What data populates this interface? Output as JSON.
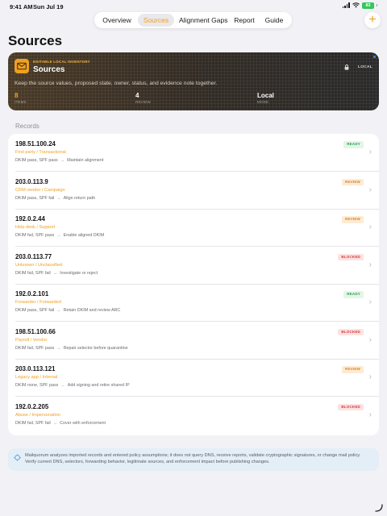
{
  "status_bar": {
    "time": "9:41 AM",
    "date": "Sun Jul 19",
    "battery": "83"
  },
  "nav": {
    "tabs": [
      {
        "label": "Overview",
        "active": false
      },
      {
        "label": "Sources",
        "active": true
      },
      {
        "label": "Alignment Gaps",
        "active": false
      },
      {
        "label": "Report",
        "active": false
      },
      {
        "label": "Guide",
        "active": false
      }
    ],
    "add_icon": "plus-icon"
  },
  "page": {
    "title": "Sources"
  },
  "hero": {
    "eyebrow": "EDITABLE LOCAL INVENTORY",
    "title": "Sources",
    "badge": "LOCAL",
    "description": "Keep the source values, proposed state, owner, status, and evidence note together.",
    "stats": [
      {
        "value": "8",
        "label": "ITEMS",
        "accent": true
      },
      {
        "value": "4",
        "label": "REVIEW",
        "accent": false
      },
      {
        "value": "Local",
        "label": "MODE",
        "accent": false
      }
    ]
  },
  "records": {
    "label": "Records",
    "items": [
      {
        "ip": "198.51.100.24",
        "category": "First party / Transactional",
        "status": "READY",
        "status_key": "ready",
        "checks": "DKIM pass, SPF pass",
        "action": "Maintain alignment"
      },
      {
        "ip": "203.0.113.9",
        "category": "CRM vendor / Campaign",
        "status": "REVIEW",
        "status_key": "review",
        "checks": "DKIM pass, SPF fail",
        "action": "Align return path"
      },
      {
        "ip": "192.0.2.44",
        "category": "Help desk / Support",
        "status": "REVIEW",
        "status_key": "review",
        "checks": "DKIM fail, SPF pass",
        "action": "Enable aligned DKIM"
      },
      {
        "ip": "203.0.113.77",
        "category": "Unknown / Unclassified",
        "status": "BLOCKED",
        "status_key": "blocked",
        "checks": "DKIM fail, SPF fail",
        "action": "Investigate or reject"
      },
      {
        "ip": "192.0.2.101",
        "category": "Forwarder / Forwarded",
        "status": "READY",
        "status_key": "ready",
        "checks": "DKIM pass, SPF fail",
        "action": "Retain DKIM and review ARC"
      },
      {
        "ip": "198.51.100.66",
        "category": "Payroll / Vendor",
        "status": "BLOCKED",
        "status_key": "blocked",
        "checks": "DKIM fail, SPF pass",
        "action": "Repair selector before quarantine"
      },
      {
        "ip": "203.0.113.121",
        "category": "Legacy app / Internal",
        "status": "REVIEW",
        "status_key": "review",
        "checks": "DKIM none, SPF pass",
        "action": "Add signing and retire shared IP"
      },
      {
        "ip": "192.0.2.205",
        "category": "Abuse / Impersonation",
        "status": "BLOCKED",
        "status_key": "blocked",
        "checks": "DKIM fail, SPF fail",
        "action": "Cover with enforcement"
      }
    ]
  },
  "note": {
    "text": "Mailquorum analyzes imported records and entered policy assumptions; it does not query DNS, receive reports, validate cryptographic signatures, or change mail policy. Verify current DNS, selectors, forwarding behavior, legitimate sources, and enforcement impact before publishing changes."
  },
  "colors": {
    "accent": "#f0a020",
    "ready": "#2e9c49",
    "review": "#d8842a",
    "blocked": "#d33a3a"
  }
}
